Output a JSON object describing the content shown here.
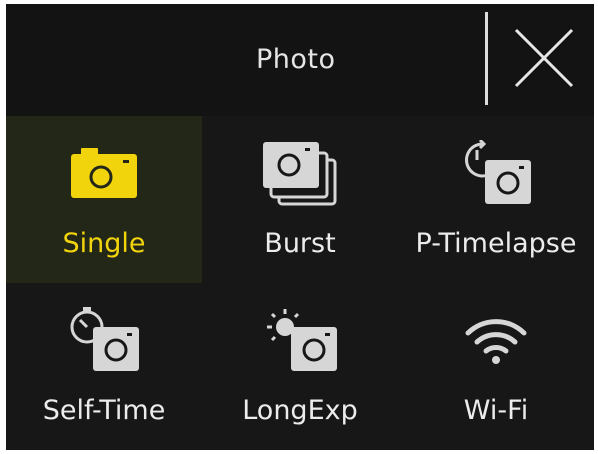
{
  "header": {
    "title": "Photo"
  },
  "colors": {
    "accent": "#f2d40c",
    "icon": "#d6d6d6",
    "background": "#141414"
  },
  "modes": [
    {
      "label": "Single",
      "icon": "camera-icon",
      "selected": true
    },
    {
      "label": "Burst",
      "icon": "burst-camera-icon",
      "selected": false
    },
    {
      "label": "P-Timelapse",
      "icon": "timelapse-camera-icon",
      "selected": false
    },
    {
      "label": "Self-Time",
      "icon": "self-timer-camera-icon",
      "selected": false
    },
    {
      "label": "LongExp",
      "icon": "long-exposure-camera-icon",
      "selected": false
    },
    {
      "label": "Wi-Fi",
      "icon": "wifi-icon",
      "selected": false
    }
  ]
}
